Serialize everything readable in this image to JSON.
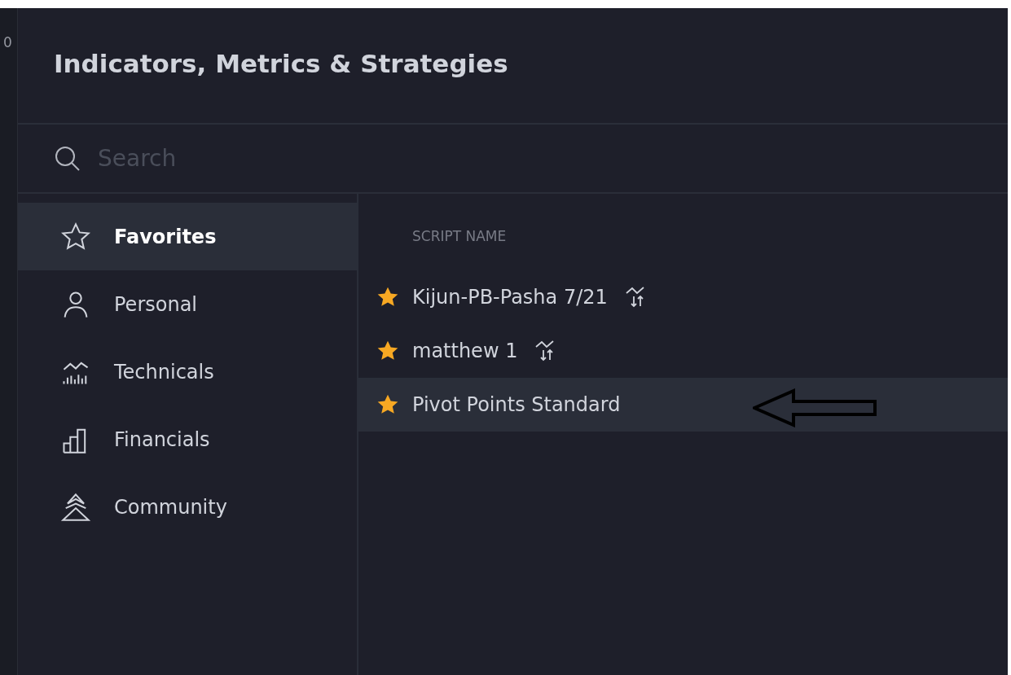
{
  "chart_edge": {
    "label": "0"
  },
  "dialog": {
    "title": "Indicators, Metrics & Strategies"
  },
  "search": {
    "placeholder": "Search"
  },
  "sidebar": {
    "items": [
      {
        "label": "Favorites",
        "selected": true
      },
      {
        "label": "Personal",
        "selected": false
      },
      {
        "label": "Technicals",
        "selected": false
      },
      {
        "label": "Financials",
        "selected": false
      },
      {
        "label": "Community",
        "selected": false
      }
    ]
  },
  "scripts": {
    "column": "SCRIPT NAME",
    "rows": [
      {
        "name": "Kijun-PB-Pasha 7/21",
        "favorite": true,
        "strategy": true,
        "selected": false,
        "arrow_annotation": false
      },
      {
        "name": "matthew 1",
        "favorite": true,
        "strategy": true,
        "selected": false,
        "arrow_annotation": false
      },
      {
        "name": "Pivot Points Standard",
        "favorite": true,
        "strategy": false,
        "selected": true,
        "arrow_annotation": true
      }
    ]
  }
}
